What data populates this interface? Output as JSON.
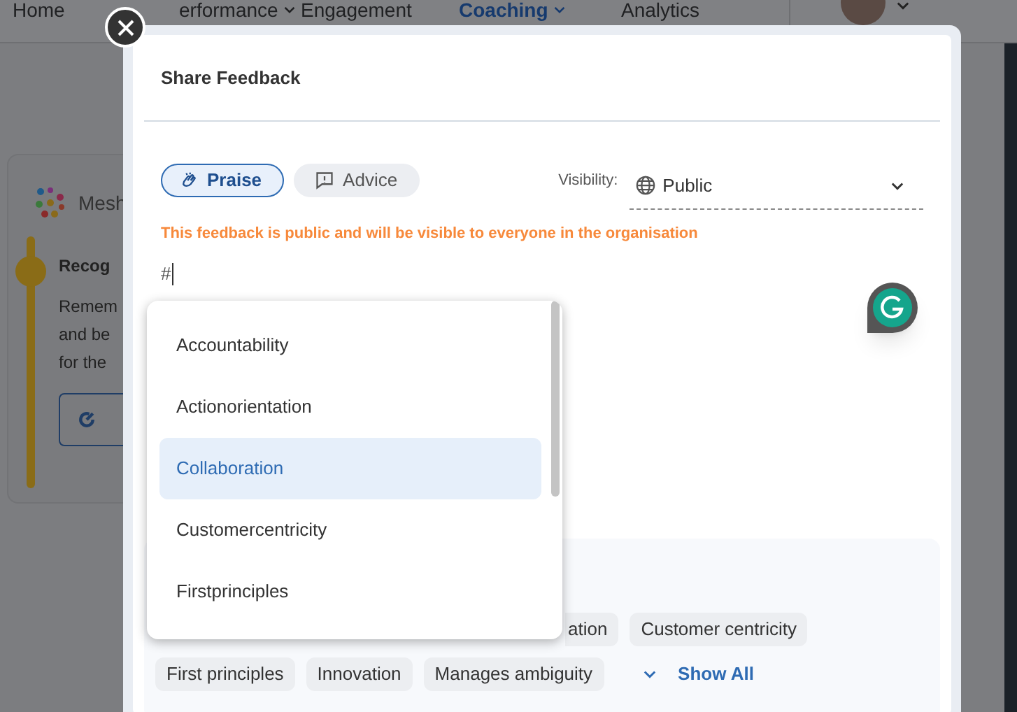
{
  "nav": {
    "items": [
      {
        "label": "Home",
        "selected": false,
        "dropdown": false
      },
      {
        "label": "erformance",
        "selected": false,
        "dropdown": true
      },
      {
        "label": "Engagement",
        "selected": false,
        "dropdown": false
      },
      {
        "label": "Coaching",
        "selected": true,
        "dropdown": true
      },
      {
        "label": "Analytics",
        "selected": false,
        "dropdown": false
      }
    ]
  },
  "background_card": {
    "app_name": "Mesh",
    "section_title": "Recog",
    "lines": [
      "Remem",
      "and be",
      "for the"
    ]
  },
  "modal": {
    "title": "Share Feedback",
    "types": [
      {
        "label": "Praise",
        "kind": "praise",
        "selected": true
      },
      {
        "label": "Advice",
        "kind": "advice",
        "selected": false
      }
    ],
    "visibility_label": "Visibility:",
    "visibility_value": "Public",
    "notice": "This feedback is public and will be visible to everyone in the organisation",
    "input_value": "#",
    "suggestions": [
      {
        "label": "Accountability",
        "selected": false
      },
      {
        "label": "Actionorientation",
        "selected": false
      },
      {
        "label": "Collaboration",
        "selected": true
      },
      {
        "label": "Customercentricity",
        "selected": false
      },
      {
        "label": "Firstprinciples",
        "selected": false
      }
    ],
    "tag_rows": [
      [
        "ation",
        "Customer centricity"
      ],
      [
        "First principles",
        "Innovation",
        "Manages ambiguity"
      ]
    ],
    "show_all": "Show All"
  }
}
